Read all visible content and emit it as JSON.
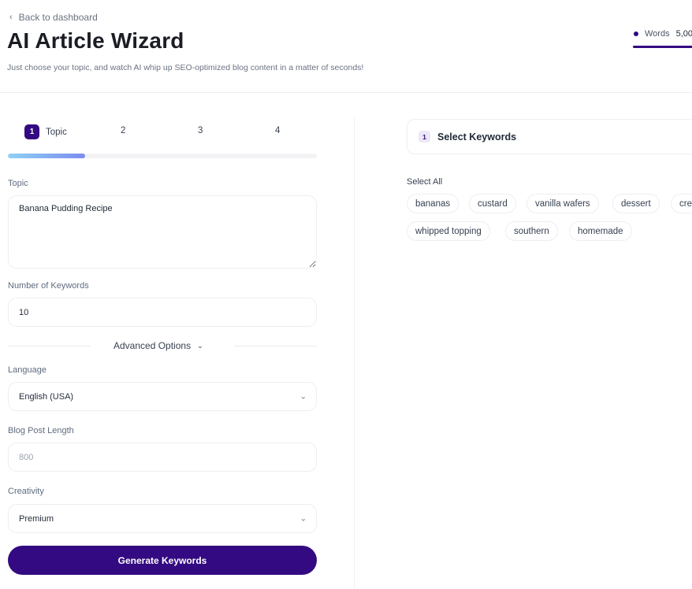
{
  "header": {
    "back_label": "Back to dashboard",
    "back_icon": "chevron-left-icon",
    "title": "AI Article Wizard",
    "subtitle": "Just choose your topic, and watch AI whip up SEO-optimized blog content in a matter of seconds!",
    "words_label": "Words",
    "words_value": "5,00",
    "words_dot_color": "#330a81"
  },
  "steps": {
    "items": [
      {
        "number": "1",
        "label": "Topic",
        "active": true
      },
      {
        "number": "2",
        "label": ""
      },
      {
        "number": "3",
        "label": ""
      },
      {
        "number": "4",
        "label": ""
      }
    ],
    "progress_fraction": 0.25
  },
  "form": {
    "topic": {
      "label": "Topic",
      "value": "Banana Pudding Recipe"
    },
    "keywords_count": {
      "label": "Number of Keywords",
      "value": "10"
    },
    "advanced": {
      "label": "Advanced Options",
      "icon": "chevron-down-icon"
    },
    "language": {
      "label": "Language",
      "value": "English (USA)"
    },
    "length": {
      "label": "Blog Post Length",
      "placeholder": "800"
    },
    "creativity": {
      "label": "Creativity",
      "value": "Premium"
    },
    "submit_label": "Generate Keywords"
  },
  "keywords_panel": {
    "step_number": "1",
    "title": "Select Keywords",
    "select_all_label": "Select All",
    "chips": [
      "bananas",
      "custard",
      "vanilla wafers",
      "dessert",
      "cre",
      "whipped topping",
      "southern",
      "homemade"
    ]
  },
  "colors": {
    "brand": "#330a81",
    "progress_start": "#8fd1f5",
    "progress_end": "#7c8cf0"
  }
}
